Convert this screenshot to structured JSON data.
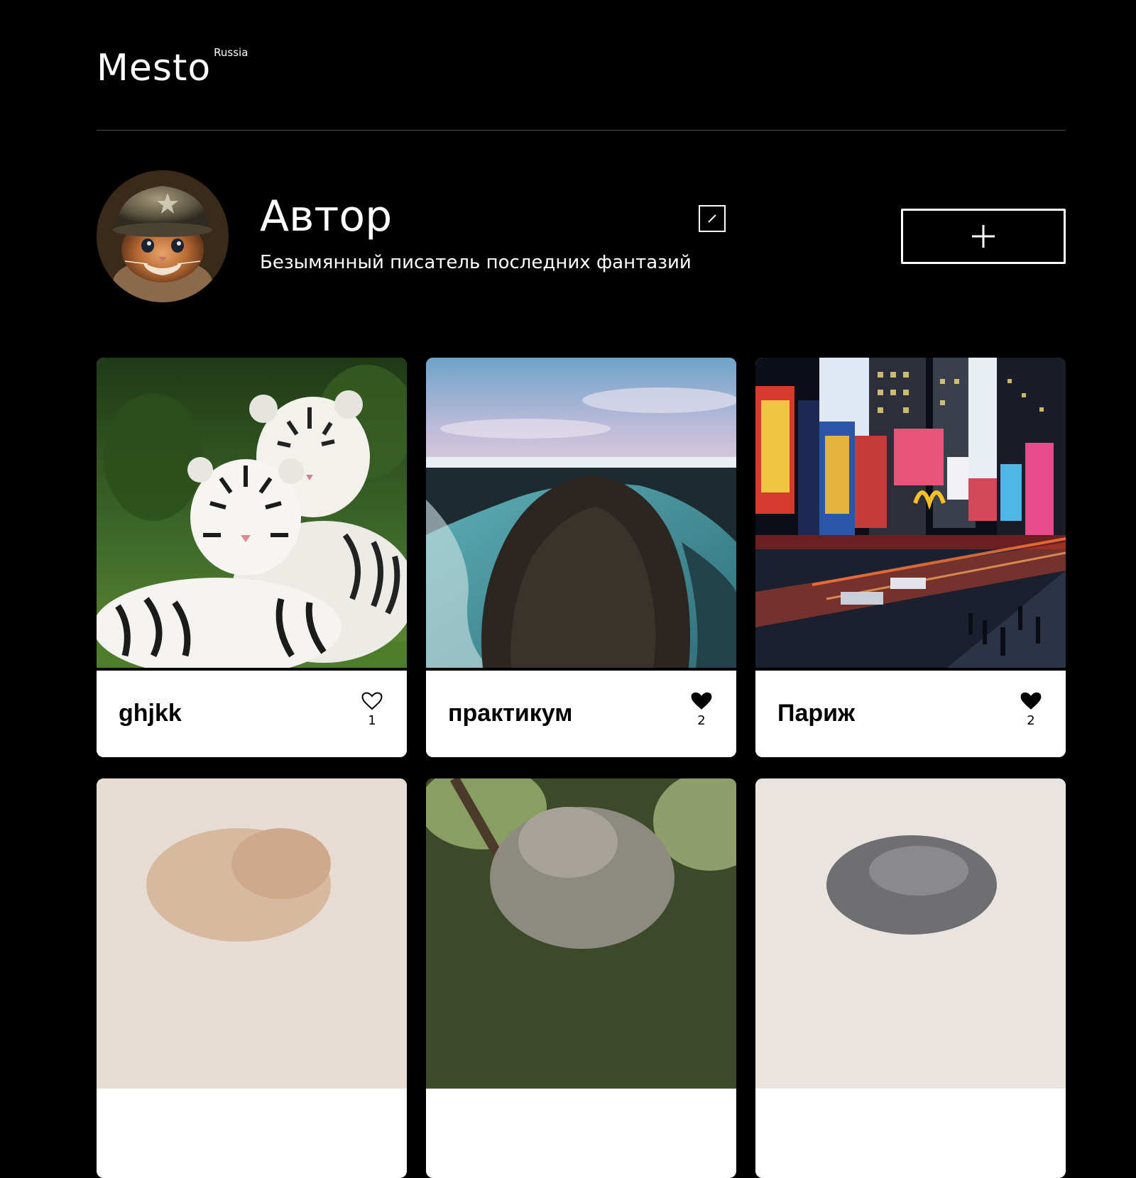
{
  "header": {
    "logo": "Mesto",
    "logo_sup": "Russia"
  },
  "profile": {
    "name": "Автор",
    "about": "Безымянный писатель последних фантазий"
  },
  "cards": [
    {
      "title": "ghjkk",
      "likes": "1",
      "liked": false
    },
    {
      "title": "практикум",
      "likes": "2",
      "liked": true
    },
    {
      "title": "Париж",
      "likes": "2",
      "liked": true
    }
  ],
  "icons": {
    "edit": "pencil-icon",
    "add": "plus-icon",
    "like": "heart-icon"
  },
  "colors": {
    "background": "#000000",
    "card": "#ffffff",
    "divider": "#545454"
  }
}
